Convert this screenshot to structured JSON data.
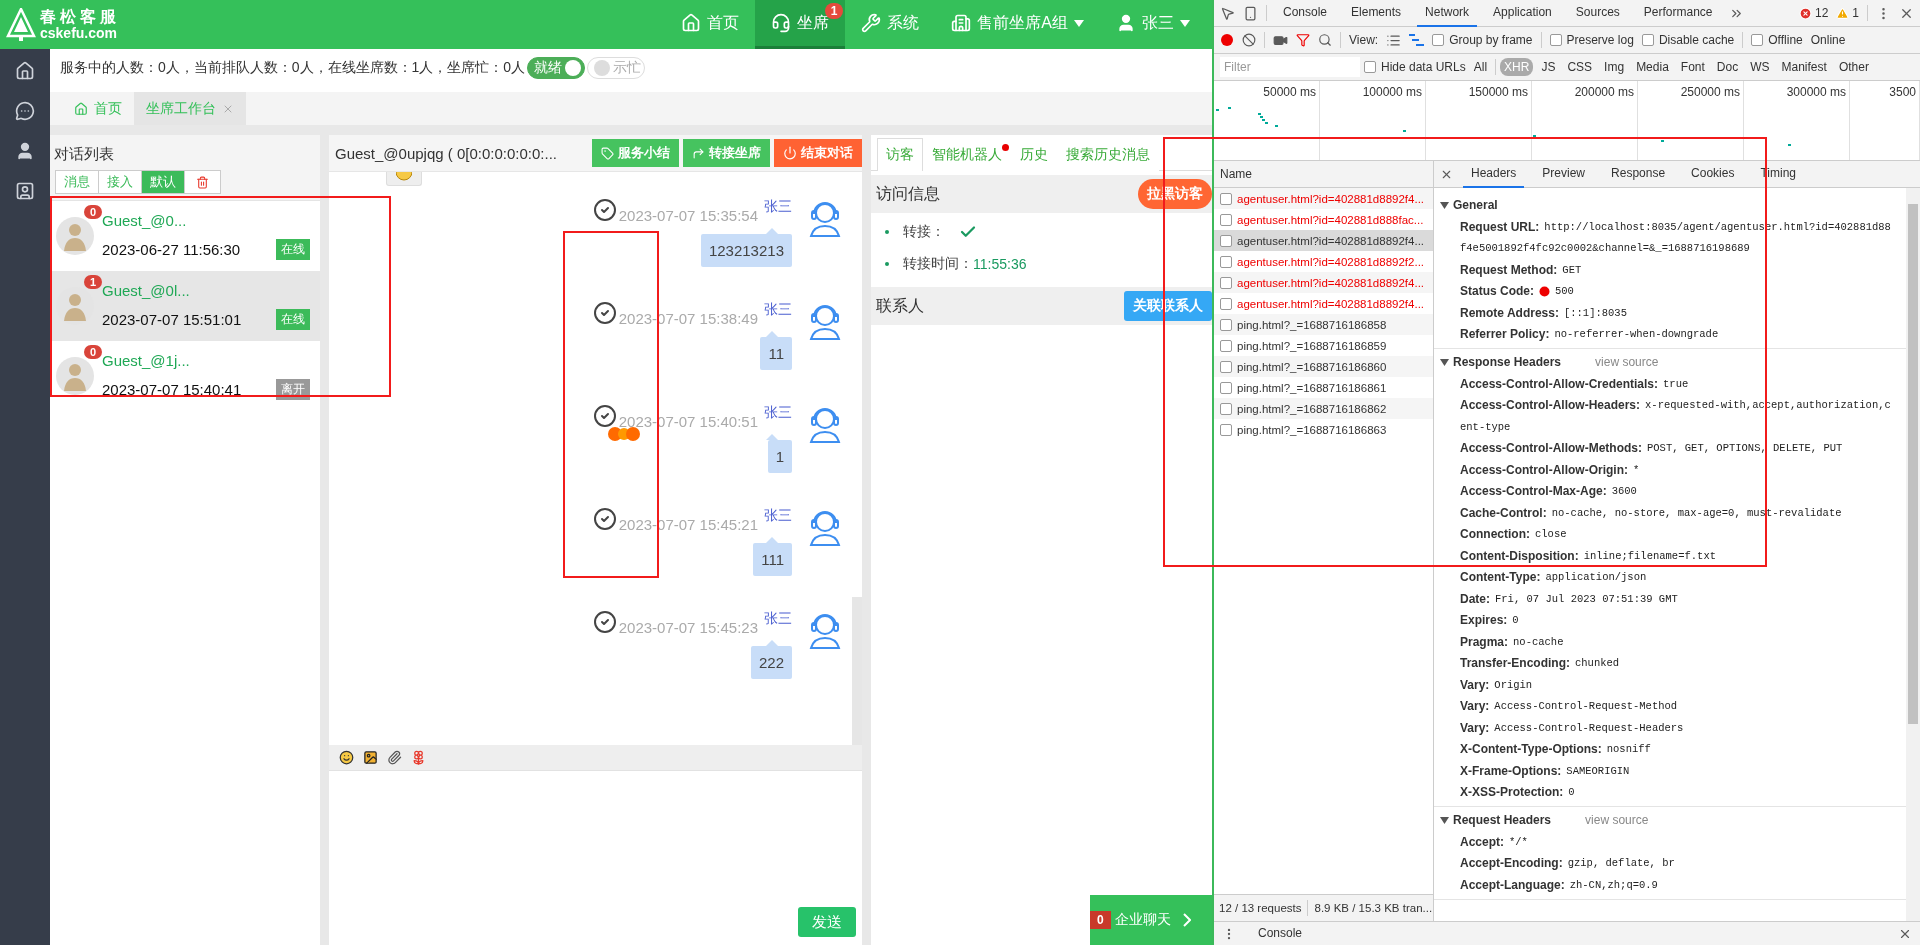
{
  "header": {
    "logo_title": "春松客服",
    "logo_subtitle": "cskefu.com",
    "nav": [
      {
        "kind": "home",
        "label": "首页",
        "selected": false
      },
      {
        "kind": "agent",
        "label": "坐席",
        "badge": "1",
        "selected": true
      },
      {
        "kind": "system",
        "label": "系统",
        "selected": false
      },
      {
        "kind": "group",
        "label": "售前坐席A组",
        "selected": false,
        "dropdown": true
      },
      {
        "kind": "user",
        "label": "张三",
        "selected": false,
        "dropdown": true
      }
    ]
  },
  "status": {
    "text": "服务中的人数：0人，当前排队人数：0人，在线坐席数：1人，坐席忙：0人",
    "toggles": [
      {
        "label": "就绪",
        "on": true
      },
      {
        "label": "示忙",
        "on": false
      }
    ]
  },
  "page_tabs": [
    {
      "label": "首页",
      "selected": false,
      "closable": false
    },
    {
      "label": "坐席工作台",
      "selected": true,
      "closable": true
    }
  ],
  "conversation_list": {
    "title": "对话列表",
    "filters": [
      {
        "kind": "text",
        "label": "消息",
        "selected": false
      },
      {
        "kind": "text",
        "label": "接入",
        "selected": false
      },
      {
        "kind": "text",
        "label": "默认",
        "selected": true
      },
      {
        "kind": "trash",
        "selected": false
      }
    ],
    "items": [
      {
        "name": "Guest_@0...",
        "unread": "0",
        "time": "2023-06-27 11:56:30",
        "status": "在线",
        "online": true,
        "selected": false
      },
      {
        "name": "Guest_@0l...",
        "unread": "1",
        "time": "2023-07-07 15:51:01",
        "status": "在线",
        "online": true,
        "selected": true
      },
      {
        "name": "Guest_@1j...",
        "unread": "0",
        "time": "2023-07-07 15:40:41",
        "status": "离开",
        "online": false,
        "selected": false
      }
    ]
  },
  "chat": {
    "title": "Guest_@0upjqg ( 0[0:0:0:0:0:0:...",
    "actions": [
      {
        "kind": "summary",
        "label": "服务小结"
      },
      {
        "kind": "transfer",
        "label": "转接坐席"
      },
      {
        "kind": "end",
        "label": "结束对话"
      }
    ],
    "messages": [
      {
        "time": "2023-07-07 15:35:54",
        "sender": "张三",
        "text": "123213213",
        "read": true,
        "dots": false
      },
      {
        "time": "2023-07-07 15:38:49",
        "sender": "张三",
        "text": "11",
        "read": true,
        "dots": false
      },
      {
        "time": "2023-07-07 15:40:51",
        "sender": "张三",
        "text": "1",
        "read": true,
        "dots": true
      },
      {
        "time": "2023-07-07 15:45:21",
        "sender": "张三",
        "text": "111",
        "read": true,
        "dots": false
      },
      {
        "time": "2023-07-07 15:45:23",
        "sender": "张三",
        "text": "222",
        "read": true,
        "dots": false
      }
    ],
    "tools": [
      {
        "kind": "emoji"
      },
      {
        "kind": "image"
      },
      {
        "kind": "attach"
      },
      {
        "kind": "flower"
      }
    ],
    "send": "发送"
  },
  "side": {
    "tabs": [
      {
        "label": "访客",
        "selected": true,
        "dot": false
      },
      {
        "label": "智能机器人",
        "selected": false,
        "dot": true
      },
      {
        "label": "历史",
        "selected": false,
        "dot": false
      },
      {
        "label": "搜索历史消息",
        "selected": false,
        "dot": false
      }
    ],
    "visit": {
      "title": "访问信息",
      "action": "拉黑访客",
      "fields": [
        {
          "kind": "check",
          "label": "转接：",
          "checked": true
        },
        {
          "kind": "text",
          "label": "转接时间：",
          "value": "11:55:36"
        }
      ]
    },
    "contacts": {
      "title": "联系人",
      "action": "关联联系人"
    },
    "enterprise": {
      "badge": "0",
      "label": "企业聊天"
    }
  },
  "devtools": {
    "tabs": [
      {
        "label": "Console",
        "selected": false
      },
      {
        "label": "Elements",
        "selected": false
      },
      {
        "label": "Network",
        "selected": true
      },
      {
        "label": "Application",
        "selected": false
      },
      {
        "label": "Sources",
        "selected": false
      },
      {
        "label": "Performance",
        "selected": false
      }
    ],
    "errors": "12",
    "warnings": "1",
    "view_label": "View:",
    "options": [
      {
        "label": "Group by frame",
        "checked": false
      },
      {
        "label": "Preserve log",
        "checked": false
      },
      {
        "label": "Disable cache",
        "checked": false
      },
      {
        "label": "Offline",
        "checked": false
      }
    ],
    "throttle": "Online",
    "filter_placeholder": "Filter",
    "hide_data_urls": {
      "label": "Hide data URLs",
      "checked": false
    },
    "types": [
      {
        "label": "All",
        "selected": false
      },
      {
        "label": "XHR",
        "selected": true
      },
      {
        "label": "JS",
        "selected": false
      },
      {
        "label": "CSS",
        "selected": false
      },
      {
        "label": "Img",
        "selected": false
      },
      {
        "label": "Media",
        "selected": false
      },
      {
        "label": "Font",
        "selected": false
      },
      {
        "label": "Doc",
        "selected": false
      },
      {
        "label": "WS",
        "selected": false
      },
      {
        "label": "Manifest",
        "selected": false
      },
      {
        "label": "Other",
        "selected": false
      }
    ],
    "timeline_ticks": [
      "50000 ms",
      "100000 ms",
      "150000 ms",
      "200000 ms",
      "250000 ms",
      "300000 ms",
      "3500"
    ],
    "name_header": "Name",
    "requests": [
      {
        "name": "agentuser.html?id=402881d8892f4...",
        "error": true,
        "selected": false
      },
      {
        "name": "agentuser.html?id=402881d888fac...",
        "error": true,
        "selected": false
      },
      {
        "name": "agentuser.html?id=402881d8892f4...",
        "error": false,
        "selected": true
      },
      {
        "name": "agentuser.html?id=402881d8892f2...",
        "error": true,
        "selected": false
      },
      {
        "name": "agentuser.html?id=402881d8892f4...",
        "error": true,
        "selected": false
      },
      {
        "name": "agentuser.html?id=402881d8892f4...",
        "error": true,
        "selected": false
      },
      {
        "name": "ping.html?_=1688716186858",
        "error": false,
        "selected": false
      },
      {
        "name": "ping.html?_=1688716186859",
        "error": false,
        "selected": false
      },
      {
        "name": "ping.html?_=1688716186860",
        "error": false,
        "selected": false
      },
      {
        "name": "ping.html?_=1688716186861",
        "error": false,
        "selected": false
      },
      {
        "name": "ping.html?_=1688716186862",
        "error": false,
        "selected": false
      },
      {
        "name": "ping.html?_=1688716186863",
        "error": false,
        "selected": false
      }
    ],
    "summary": [
      "12 / 13 requests",
      "8.9 KB / 15.3 KB tran..."
    ],
    "detail_tabs": [
      {
        "label": "Headers",
        "selected": true
      },
      {
        "label": "Preview",
        "selected": false
      },
      {
        "label": "Response",
        "selected": false
      },
      {
        "label": "Cookies",
        "selected": false
      },
      {
        "label": "Timing",
        "selected": false
      }
    ],
    "sections": [
      {
        "title": "General",
        "expanded": true,
        "rows": [
          {
            "kind": "text",
            "name": "Request URL:",
            "value": "http://localhost:8035/agent/agentuser.html?id=402881d88",
            "continued": "f4e5001892f4fc92c0002&channel=&_=1688716198689"
          },
          {
            "kind": "text",
            "name": "Request Method:",
            "value": "GET"
          },
          {
            "kind": "status",
            "name": "Status Code:",
            "value": "500"
          },
          {
            "kind": "text",
            "name": "Remote Address:",
            "value": "[::1]:8035"
          },
          {
            "kind": "text",
            "name": "Referrer Policy:",
            "value": "no-referrer-when-downgrade"
          }
        ]
      },
      {
        "title": "Response Headers",
        "link": "view source",
        "expanded": true,
        "rows": [
          {
            "kind": "text",
            "name": "Access-Control-Allow-Credentials:",
            "value": "true"
          },
          {
            "kind": "text",
            "name": "Access-Control-Allow-Headers:",
            "value": "x-requested-with,accept,authorization,c",
            "continued": "ent-type"
          },
          {
            "kind": "text",
            "name": "Access-Control-Allow-Methods:",
            "value": "POST, GET, OPTIONS, DELETE, PUT"
          },
          {
            "kind": "text",
            "name": "Access-Control-Allow-Origin:",
            "value": "*"
          },
          {
            "kind": "text",
            "name": "Access-Control-Max-Age:",
            "value": "3600"
          },
          {
            "kind": "text",
            "name": "Cache-Control:",
            "value": "no-cache, no-store, max-age=0, must-revalidate"
          },
          {
            "kind": "text",
            "name": "Connection:",
            "value": "close"
          },
          {
            "kind": "text",
            "name": "Content-Disposition:",
            "value": "inline;filename=f.txt"
          },
          {
            "kind": "text",
            "name": "Content-Type:",
            "value": "application/json"
          },
          {
            "kind": "text",
            "name": "Date:",
            "value": "Fri, 07 Jul 2023 07:51:39 GMT"
          },
          {
            "kind": "text",
            "name": "Expires:",
            "value": "0"
          },
          {
            "kind": "text",
            "name": "Pragma:",
            "value": "no-cache"
          },
          {
            "kind": "text",
            "name": "Transfer-Encoding:",
            "value": "chunked"
          },
          {
            "kind": "text",
            "name": "Vary:",
            "value": "Origin"
          },
          {
            "kind": "text",
            "name": "Vary:",
            "value": "Access-Control-Request-Method"
          },
          {
            "kind": "text",
            "name": "Vary:",
            "value": "Access-Control-Request-Headers"
          },
          {
            "kind": "text",
            "name": "X-Content-Type-Options:",
            "value": "nosniff"
          },
          {
            "kind": "text",
            "name": "X-Frame-Options:",
            "value": "SAMEORIGIN"
          },
          {
            "kind": "text",
            "name": "X-XSS-Protection:",
            "value": "0"
          }
        ]
      },
      {
        "title": "Request Headers",
        "link": "view source",
        "expanded": true,
        "rows": [
          {
            "kind": "text",
            "name": "Accept:",
            "value": "*/*"
          },
          {
            "kind": "text",
            "name": "Accept-Encoding:",
            "value": "gzip, deflate, br"
          },
          {
            "kind": "text",
            "name": "Accept-Language:",
            "value": "zh-CN,zh;q=0.9"
          }
        ]
      }
    ],
    "drawer": "Console"
  }
}
